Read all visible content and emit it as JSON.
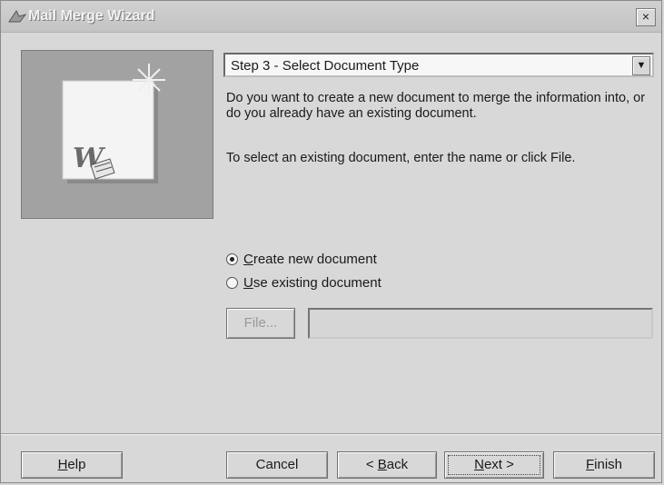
{
  "window": {
    "title": "Mail Merge Wizard",
    "close_label": "×"
  },
  "wizard": {
    "step_label": "Step 3 - Select Document Type",
    "description": "Do you want to create a new document to merge the information into, or do you already have an existing document.",
    "instruction": "To select an existing document, enter the name or click File."
  },
  "options": {
    "create_new": {
      "accel": "C",
      "rest": "reate new document",
      "checked": true
    },
    "use_existing": {
      "accel": "U",
      "rest": "se existing document",
      "checked": false
    }
  },
  "file": {
    "button_label": "File...",
    "path_value": ""
  },
  "buttons": {
    "help": {
      "accel": "H",
      "rest": "elp"
    },
    "cancel": {
      "label": "Cancel"
    },
    "back": {
      "pre": "< ",
      "accel": "B",
      "rest": "ack"
    },
    "next": {
      "pre": "",
      "accel": "N",
      "rest": "ext >"
    },
    "finish": {
      "accel": "F",
      "rest": "inish"
    }
  },
  "icons": {
    "app": "wizard-hat-icon",
    "illustration": "word-document-icon"
  }
}
